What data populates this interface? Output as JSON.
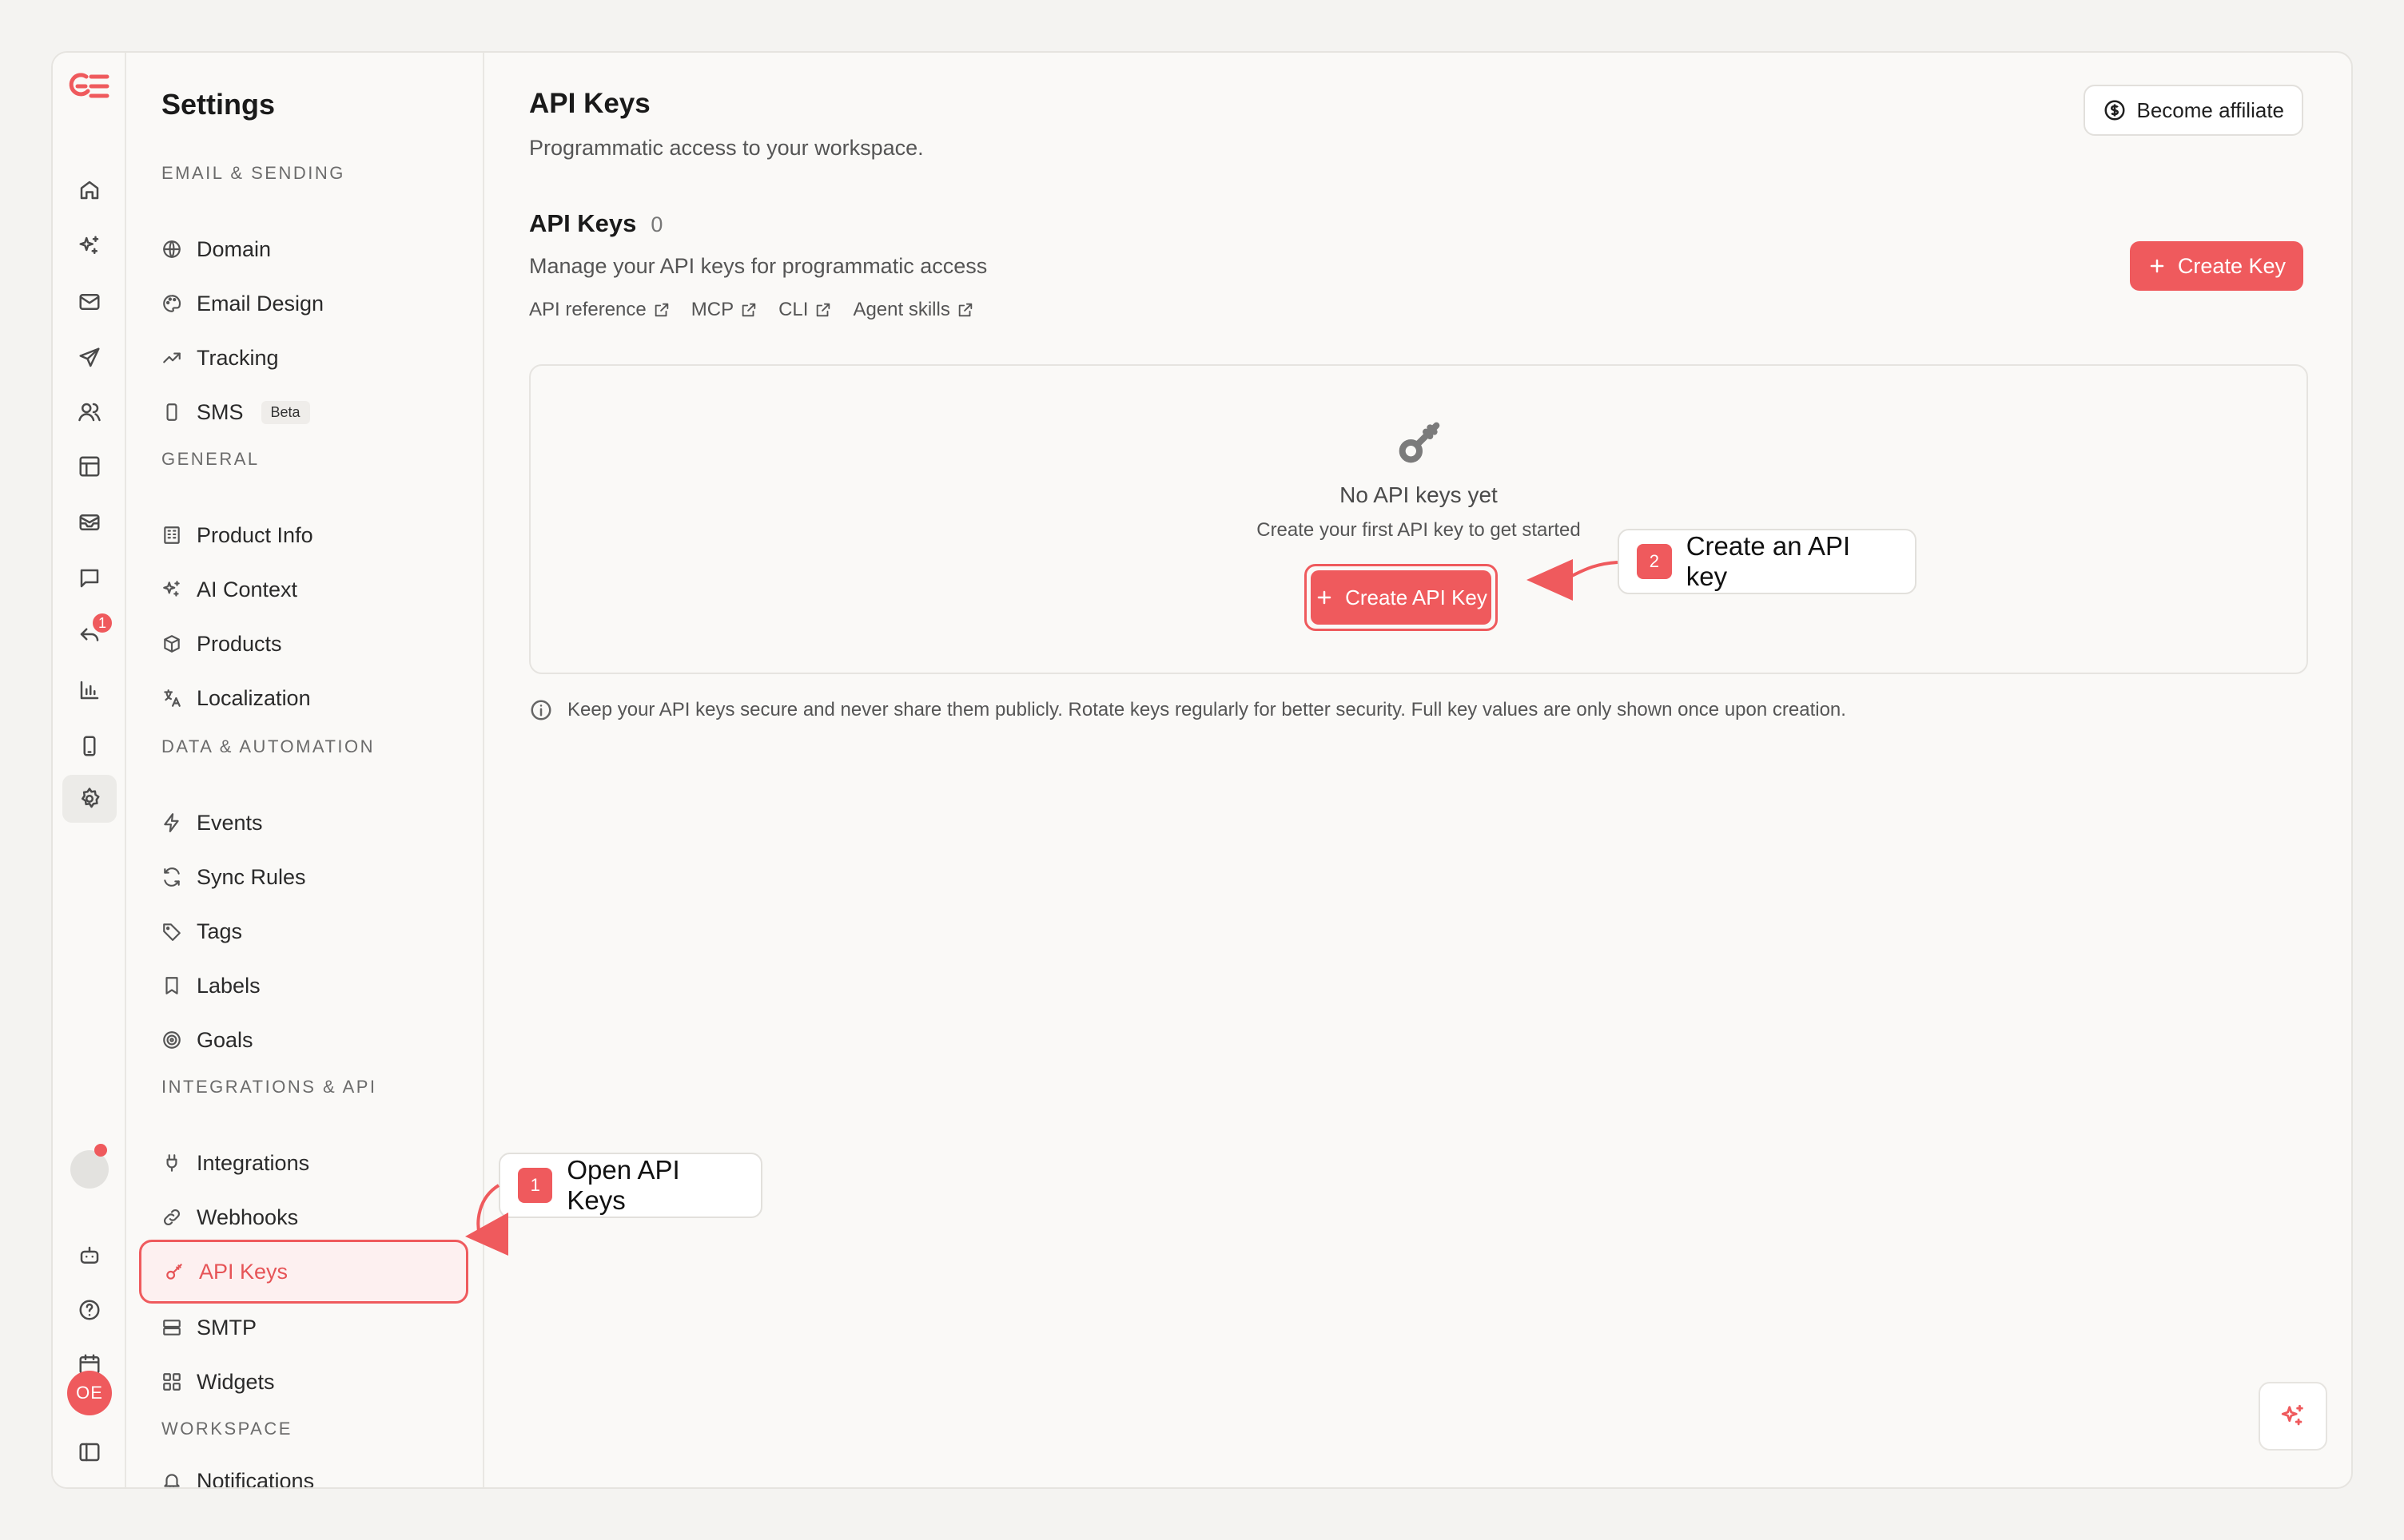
{
  "rail": {
    "notification_count": "1",
    "avatar_initials": "OE",
    "items": [
      "home-icon",
      "sparkles-icon",
      "mail-icon",
      "send-icon",
      "users-icon",
      "layout-icon",
      "inbox-icon",
      "message-icon",
      "reply-icon",
      "chart-icon",
      "mobile-icon",
      "settings-icon"
    ]
  },
  "settings": {
    "title": "Settings",
    "sections": [
      {
        "label": "EMAIL & SENDING",
        "items": [
          {
            "label": "Domain",
            "icon": "globe-icon"
          },
          {
            "label": "Email Design",
            "icon": "palette-icon"
          },
          {
            "label": "Tracking",
            "icon": "trend-icon"
          },
          {
            "label": "SMS",
            "icon": "phone-icon",
            "badge": "Beta"
          }
        ]
      },
      {
        "label": "GENERAL",
        "items": [
          {
            "label": "Product Info",
            "icon": "building-icon"
          },
          {
            "label": "AI Context",
            "icon": "sparkles-icon"
          },
          {
            "label": "Products",
            "icon": "box-icon"
          },
          {
            "label": "Localization",
            "icon": "translate-icon"
          }
        ]
      },
      {
        "label": "DATA & AUTOMATION",
        "items": [
          {
            "label": "Events",
            "icon": "bolt-icon"
          },
          {
            "label": "Sync Rules",
            "icon": "refresh-icon"
          },
          {
            "label": "Tags",
            "icon": "tag-icon"
          },
          {
            "label": "Labels",
            "icon": "bookmark-icon"
          },
          {
            "label": "Goals",
            "icon": "target-icon"
          }
        ]
      },
      {
        "label": "INTEGRATIONS & API",
        "items": [
          {
            "label": "Integrations",
            "icon": "plug-icon"
          },
          {
            "label": "Webhooks",
            "icon": "link-icon"
          },
          {
            "label": "API Keys",
            "icon": "key-icon",
            "active": true
          },
          {
            "label": "SMTP",
            "icon": "server-icon"
          },
          {
            "label": "Widgets",
            "icon": "grid-icon"
          }
        ]
      },
      {
        "label": "WORKSPACE",
        "items": [
          {
            "label": "Notifications",
            "icon": "bell-icon"
          }
        ]
      }
    ]
  },
  "main": {
    "title": "API Keys",
    "subtitle": "Programmatic access to your workspace.",
    "affiliate_label": "Become affiliate",
    "section_title": "API Keys",
    "section_count": "0",
    "section_desc": "Manage your API keys for programmatic access",
    "links": [
      "API reference",
      "MCP",
      "CLI",
      "Agent skills"
    ],
    "create_key_label": "Create Key",
    "empty_title": "No API keys yet",
    "empty_sub": "Create your first API key to get started",
    "create_api_label": "Create API Key",
    "info_text": "Keep your API keys secure and never share them publicly. Rotate keys regularly for better security. Full key values are only shown once upon creation."
  },
  "callouts": [
    {
      "num": "1",
      "text": "Open API Keys"
    },
    {
      "num": "2",
      "text": "Create an API key"
    }
  ],
  "colors": {
    "accent": "#ef5a5d",
    "background": "#faf9f7"
  }
}
